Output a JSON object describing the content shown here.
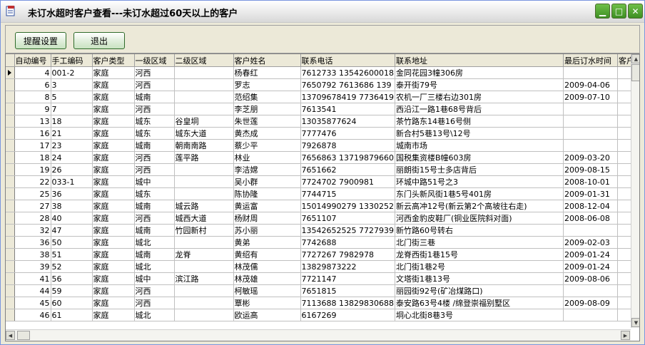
{
  "window": {
    "title": "未订水超时客户查看---未订水超过60天以上的客户"
  },
  "toolbar": {
    "remind_label": "提醒设置",
    "exit_label": "退出"
  },
  "columns": [
    "自动编号",
    "手工编码",
    "客户类型",
    "一级区域",
    "二级区域",
    "客户姓名",
    "联系电话",
    "联系地址",
    "最后订水时间",
    "客户"
  ],
  "rows": [
    [
      "4",
      "001-2",
      "家庭",
      "河西",
      "",
      "杨春红",
      "7612733 13542600018",
      "金同花园3幢306房",
      ""
    ],
    [
      "6",
      "3",
      "家庭",
      "河西",
      "",
      "罗志",
      "7650792 7613686 139",
      "泰开街79号",
      "2009-04-06"
    ],
    [
      "8",
      "5",
      "家庭",
      "城南",
      "",
      "范绍集",
      "13709678419 7736419",
      "农机一厂三楼右边301房",
      "2009-07-10"
    ],
    [
      "9",
      "7",
      "家庭",
      "河西",
      "",
      "李芝朋",
      "7613541",
      "西沿江一路1巷68号背后",
      ""
    ],
    [
      "13",
      "18",
      "家庭",
      "城东",
      "谷皇垌",
      "朱世莲",
      "13035877624",
      "茶竹路东14巷16号侧",
      ""
    ],
    [
      "16",
      "21",
      "家庭",
      "城东",
      "城东大道",
      "黄杰成",
      "7777476",
      "新合村5巷13号\\12号",
      ""
    ],
    [
      "17",
      "23",
      "家庭",
      "城南",
      "朝南南路",
      "蔡少平",
      "7926878",
      "城南市场",
      ""
    ],
    [
      "18",
      "24",
      "家庭",
      "河西",
      "莲平路",
      "林业",
      "7656863 13719879660",
      "国税集资楼B幢603房",
      "2009-03-20"
    ],
    [
      "19",
      "26",
      "家庭",
      "河西",
      "",
      "李洁嫦",
      "7651662",
      "丽朗街15号士多店背后",
      "2009-08-15"
    ],
    [
      "22",
      "033-1",
      "家庭",
      "城中",
      "",
      "吴小群",
      "7724702 7900981",
      "环城中路51号之3",
      "2008-10-01"
    ],
    [
      "25",
      "36",
      "家庭",
      "城东",
      "",
      "陈协隆",
      "7744715",
      "东门头新风街1巷5号401房",
      "2009-01-31"
    ],
    [
      "27",
      "38",
      "家庭",
      "城南",
      "城云路",
      "黄运富",
      "15014990279 1330252",
      "新云高冲12号(新云第2个高坡往右走)",
      "2008-12-04"
    ],
    [
      "28",
      "40",
      "家庭",
      "河西",
      "城西大道",
      "杨财周",
      "7651107",
      "河西金豹皮鞋厂(铜业医院斜对面)",
      "2008-06-08"
    ],
    [
      "32",
      "47",
      "家庭",
      "城南",
      "竹园新村",
      "苏小丽",
      "13542652525 7727939",
      "新竹路60号转右",
      ""
    ],
    [
      "36",
      "50",
      "家庭",
      "城北",
      "",
      "黄弟",
      "7742688",
      "北门街三巷",
      "2009-02-03"
    ],
    [
      "38",
      "51",
      "家庭",
      "城南",
      "龙脊",
      "黄绍有",
      "7727267 7982978",
      "龙脊西街1巷15号",
      "2009-01-24"
    ],
    [
      "39",
      "52",
      "家庭",
      "城北",
      "",
      "林茂儒",
      "13829873222",
      "北门街1巷2号",
      "2009-01-24"
    ],
    [
      "41",
      "56",
      "家庭",
      "城中",
      "滨江路",
      "林茂雄",
      "7721147",
      "文塔街1巷13号",
      "2009-08-06"
    ],
    [
      "44",
      "59",
      "家庭",
      "河西",
      "",
      "柯敏瑶",
      "7651815",
      "丽园街92号(矿冶煤路口)",
      ""
    ],
    [
      "45",
      "60",
      "家庭",
      "河西",
      "",
      "覃彬",
      "7113688 13829830688",
      "泰安路63号4楼 /绵登崇福别墅区",
      "2009-08-09"
    ],
    [
      "46",
      "61",
      "家庭",
      "城北",
      "",
      "欧运高",
      "6167269",
      "垌心北街8巷3号",
      ""
    ]
  ]
}
